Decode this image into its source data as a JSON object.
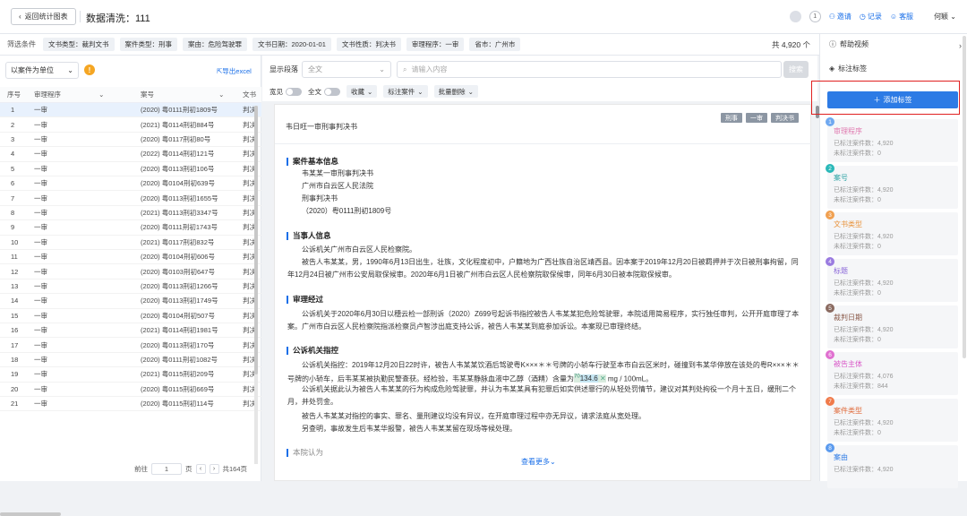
{
  "header": {
    "back_label": "返回统计图表",
    "title": "数据清洗：111",
    "notice_count": "1",
    "invite": "邀请",
    "record": "记录",
    "service": "客服",
    "user": "何颖"
  },
  "filters": {
    "label": "筛选条件",
    "tags": [
      "文书类型：裁判文书",
      "案件类型：刑事",
      "案由：危险驾驶罪",
      "文书日期：2020-01-01",
      "文书性质：判决书",
      "审理程序：一审",
      "省市：广州市"
    ],
    "total": "共 4,920 个"
  },
  "left": {
    "unit_select": "以案件为单位",
    "info": "!",
    "export": "导出excel",
    "columns": [
      "序号",
      "审理程序",
      "案号",
      "文书"
    ],
    "rows": [
      {
        "no": "1",
        "proc": "一审",
        "case": "(2020) 粤0111刑初1809号",
        "doc": "判决"
      },
      {
        "no": "2",
        "proc": "一审",
        "case": "(2021) 粤0114刑初884号",
        "doc": "判决"
      },
      {
        "no": "3",
        "proc": "一审",
        "case": "(2020) 粤0117刑初80号",
        "doc": "判决"
      },
      {
        "no": "4",
        "proc": "一审",
        "case": "(2022) 粤0114刑初121号",
        "doc": "判决"
      },
      {
        "no": "5",
        "proc": "一审",
        "case": "(2020) 粤0113刑初106号",
        "doc": "判决"
      },
      {
        "no": "6",
        "proc": "一审",
        "case": "(2020) 粤0104刑初639号",
        "doc": "判决"
      },
      {
        "no": "7",
        "proc": "一审",
        "case": "(2020) 粤0113刑初1655号",
        "doc": "判决"
      },
      {
        "no": "8",
        "proc": "一审",
        "case": "(2021) 粤0113刑初3347号",
        "doc": "判决"
      },
      {
        "no": "9",
        "proc": "一审",
        "case": "(2020) 粤0111刑初1743号",
        "doc": "判决"
      },
      {
        "no": "10",
        "proc": "一审",
        "case": "(2021) 粤0117刑初832号",
        "doc": "判决"
      },
      {
        "no": "11",
        "proc": "一审",
        "case": "(2020) 粤0104刑初606号",
        "doc": "判决"
      },
      {
        "no": "12",
        "proc": "一审",
        "case": "(2020) 粤0103刑初647号",
        "doc": "判决"
      },
      {
        "no": "13",
        "proc": "一审",
        "case": "(2020) 粤0113刑初1266号",
        "doc": "判决"
      },
      {
        "no": "14",
        "proc": "一审",
        "case": "(2020) 粤0113刑初1749号",
        "doc": "判决"
      },
      {
        "no": "15",
        "proc": "一审",
        "case": "(2020) 粤0104刑初507号",
        "doc": "判决"
      },
      {
        "no": "16",
        "proc": "一审",
        "case": "(2021) 粤0114刑初1981号",
        "doc": "判决"
      },
      {
        "no": "17",
        "proc": "一审",
        "case": "(2020) 粤0113刑初170号",
        "doc": "判决"
      },
      {
        "no": "18",
        "proc": "一审",
        "case": "(2020) 粤0111刑初1082号",
        "doc": "判决"
      },
      {
        "no": "19",
        "proc": "一审",
        "case": "(2021) 粤0115刑初209号",
        "doc": "判决"
      },
      {
        "no": "20",
        "proc": "一审",
        "case": "(2020) 粤0115刑初669号",
        "doc": "判决"
      },
      {
        "no": "21",
        "proc": "一审",
        "case": "(2020) 粤0115刑初114号",
        "doc": "判决"
      }
    ],
    "pager": {
      "prefix": "前往",
      "page": "1",
      "suffix": "页",
      "total": "共164页"
    }
  },
  "middle": {
    "display_label": "显示段落",
    "display_value": "全文",
    "search_placeholder": "请输入内容",
    "search_btn": "搜索",
    "tools": {
      "wide": "宽见",
      "full": "全文",
      "collect": "收藏",
      "tag_case": "标注案件",
      "batch_delete": "批量删除"
    }
  },
  "doc": {
    "title": "韦日旺一审刑事判决书",
    "tags": [
      "刑事",
      "一审",
      "判决书"
    ],
    "sec1": "案件基本信息",
    "basic": [
      "韦某某一审刑事判决书",
      "广州市白云区人民法院",
      "刑事判决书",
      "（2020）粤0111刑初1809号"
    ],
    "sec2": "当事人信息",
    "party1": "公诉机关广州市白云区人民检察院。",
    "party2": "被告人韦某某，男，1990年6月13日出生，壮族，文化程度初中，户籍地为广西壮族自治区靖西县。因本案于2019年12月20日被羁押并于次日被刑事拘留，同年12月24日被广州市公安局取保候审。2020年6月1日被广州市白云区人民检察院取保候审，同年6月30日被本院取保候审。",
    "sec3": "审理经过",
    "trial": "公诉机关于2020年6月30日以穗云检一部刑诉（2020）Z699号起诉书指控被告人韦某某犯危险驾驶罪，本院适用简易程序，实行独任审判，公开开庭审理了本案。广州市白云区人民检察院指派检察员卢智涉出庭支持公诉，被告人韦某某到庭参加诉讼。本案现已审理终结。",
    "sec4": "公诉机关指控",
    "charge1a": "公诉机关指控：2019年12月20日22时许，被告人韦某某饮酒后驾驶粤K×××＊＊号牌的小轿车行驶至本市白云区米时，碰撞到韦某华停放在该处的粤R×××＊＊号牌的小轿车，后韦某某被执勤民警查获。经检验，韦某某静脉血液中乙醇（酒精）含量为",
    "charge1_hl": "134.6",
    "charge1_marker": "70",
    "charge1b": "mg / 100mL。",
    "charge2": "公诉机关据此认为被告人韦某某的行为构成危险驾驶罪，并认为韦某某具有犯罪后如实供述罪行的从轻处罚情节，建议对其判处拘役一个月十五日，缓刑二个月，并处罚金。",
    "charge3": "被告人韦某某对指控的事实、罪名、量刑建议均没有异议，在开庭审理过程中亦无异议，请求法庭从宽处理。",
    "charge4": "另查明，事故发生后韦某华报警，被告人韦某某留在现场等候处理。",
    "sec5": "本院认为",
    "see_more": "查看更多"
  },
  "right": {
    "help": "帮助视频",
    "tags": "标注标签",
    "add": "添加标签",
    "cards": [
      {
        "n": "1",
        "name": "审理程序",
        "color": "#e07ab0",
        "num_color": "#6fa8f0",
        "s1": "已标注案件数：4,920",
        "s2": "未标注案件数：0"
      },
      {
        "n": "2",
        "name": "案号",
        "color": "#2aa3a3",
        "num_color": "#2ab8b8",
        "s1": "已标注案件数：4,920",
        "s2": "未标注案件数：0"
      },
      {
        "n": "3",
        "name": "文书类型",
        "color": "#e8923a",
        "num_color": "#f0a050",
        "s1": "已标注案件数：4,920",
        "s2": "未标注案件数：0"
      },
      {
        "n": "4",
        "name": "标题",
        "color": "#8a67d8",
        "num_color": "#9a7be0",
        "s1": "已标注案件数：4,920",
        "s2": "未标注案件数：0"
      },
      {
        "n": "5",
        "name": "裁判日期",
        "color": "#8a5a4a",
        "num_color": "#8a6a60",
        "s1": "已标注案件数：4,920",
        "s2": "未标注案件数：0"
      },
      {
        "n": "6",
        "name": "被告主体",
        "color": "#d958c8",
        "num_color": "#e070d0",
        "s1": "已标注案件数：4,076",
        "s2": "未标注案件数：844"
      },
      {
        "n": "7",
        "name": "案件类型",
        "color": "#e06a3a",
        "num_color": "#f07a4a",
        "s1": "已标注案件数：4,920",
        "s2": "未标注案件数：0"
      },
      {
        "n": "8",
        "name": "案由",
        "color": "#2d7be5",
        "num_color": "#5a9aee",
        "s1": "已标注案件数：4,920",
        "s2": ""
      }
    ]
  }
}
